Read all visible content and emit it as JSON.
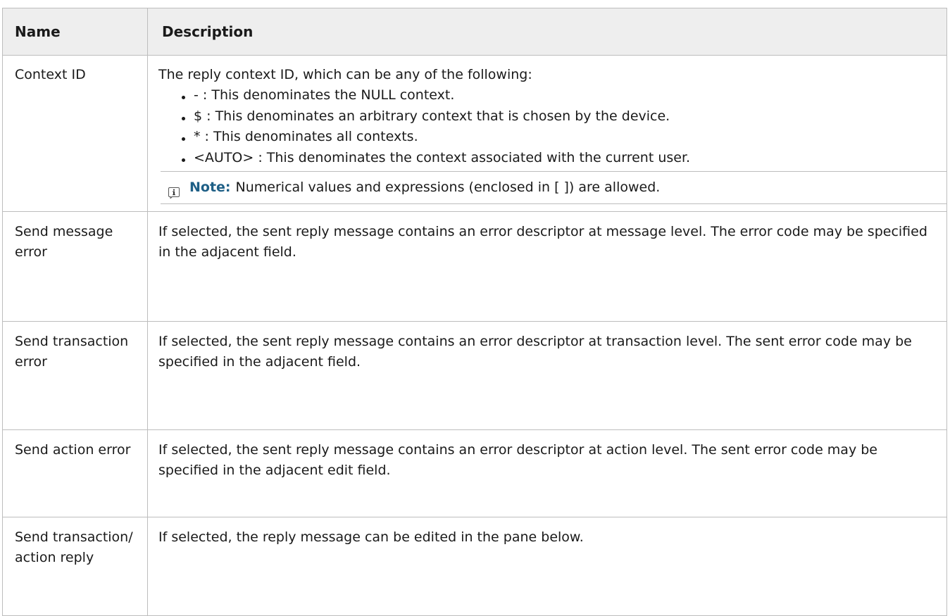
{
  "table": {
    "headers": {
      "name": "Name",
      "description": "Description"
    },
    "rows": [
      {
        "name": "Context ID",
        "description": "The reply context ID, which can be any of the following:",
        "bullets": [
          "- : This denominates the NULL context.",
          "$ : This denominates an arbitrary context that is chosen by the device.",
          "* : This denominates all contexts.",
          "<AUTO> : This denominates the context associated with the current user."
        ],
        "note": {
          "icon": "info-icon",
          "label": "Note:",
          "text": "Numerical values and expressions (enclosed in [ ]) are allowed."
        }
      },
      {
        "name": "Send message error",
        "description": "If selected, the sent reply message contains an error descriptor at message level. The error code may be specified in the adjacent field."
      },
      {
        "name": "Send transaction error",
        "description": "If selected, the sent reply message contains an error descriptor at transaction level. The sent error code may be specified in the adjacent field."
      },
      {
        "name": "Send action error",
        "description": "If selected, the sent reply message contains an error descriptor at action level. The sent error code may be specified in the adjacent edit field."
      },
      {
        "name": "Send transaction/ action reply",
        "description": "If selected, the reply message can be edited in the pane below."
      }
    ]
  },
  "colors": {
    "note_label": "#1e5f86",
    "header_bg": "#eeeeee",
    "border": "#bdbdbd"
  }
}
